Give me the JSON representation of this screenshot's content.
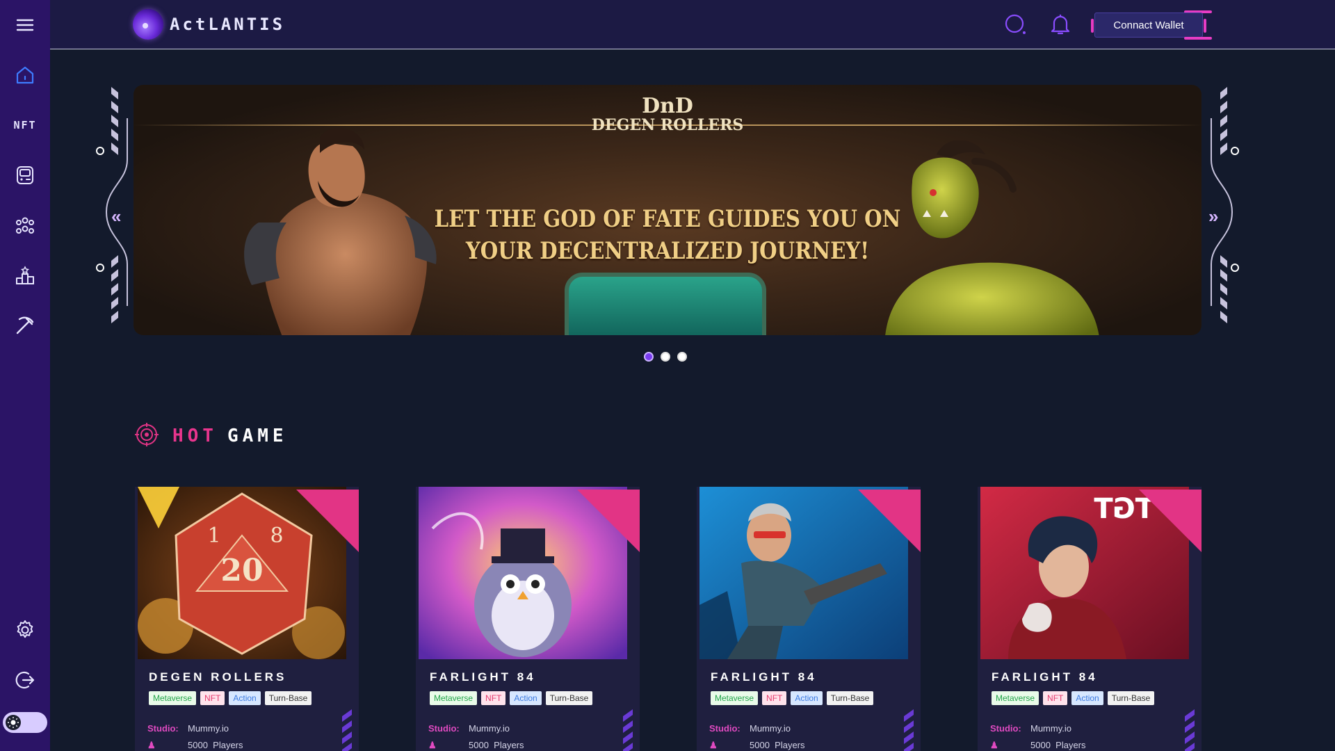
{
  "header": {
    "logo_text": "ActLANTIS",
    "connect_wallet_label": "Connact Wallet"
  },
  "sidebar": {
    "items": [
      {
        "name": "home",
        "icon": "home-icon"
      },
      {
        "name": "nft",
        "label": "NFT"
      },
      {
        "name": "games",
        "icon": "gamepad-icon"
      },
      {
        "name": "community",
        "icon": "users-icon"
      },
      {
        "name": "leaderboard",
        "icon": "podium-icon"
      },
      {
        "name": "mining",
        "icon": "pickaxe-icon"
      },
      {
        "name": "settings",
        "icon": "gear-icon"
      },
      {
        "name": "logout",
        "icon": "logout-icon"
      }
    ]
  },
  "banner": {
    "logo_line1": "DnD",
    "logo_line2": "DEGEN ROLLERS",
    "headline_line1": "LET THE GOD OF FATE GUIDES YOU ON",
    "headline_line2": "YOUR DECENTRALIZED JOURNEY!",
    "prev_arrow": "«",
    "next_arrow": "»",
    "slides": 3,
    "active_slide": 1
  },
  "hot_game": {
    "title_part1": "HOT",
    "title_part2": "GAME",
    "cards": [
      {
        "title": "DEGEN ROLLERS",
        "tags": [
          "Metaverse",
          "NFT",
          "Action",
          "Turn-Base"
        ],
        "studio_label": "Studio:",
        "studio": "Mummy.io",
        "players": "5000",
        "players_label": "Players",
        "art": "dice"
      },
      {
        "title": "FARLIGHT 84",
        "tags": [
          "Metaverse",
          "NFT",
          "Action",
          "Turn-Base"
        ],
        "studio_label": "Studio:",
        "studio": "Mummy.io",
        "players": "5000",
        "players_label": "Players",
        "art": "penguin"
      },
      {
        "title": "FARLIGHT 84",
        "tags": [
          "Metaverse",
          "NFT",
          "Action",
          "Turn-Base"
        ],
        "studio_label": "Studio:",
        "studio": "Mummy.io",
        "players": "5000",
        "players_label": "Players",
        "art": "soldier"
      },
      {
        "title": "FARLIGHT 84",
        "tags": [
          "Metaverse",
          "NFT",
          "Action",
          "Turn-Base"
        ],
        "studio_label": "Studio:",
        "studio": "Mummy.io",
        "players": "5000",
        "players_label": "Players",
        "art": "hero"
      }
    ]
  },
  "colors": {
    "sidebar_bg": "#2b1466",
    "page_bg": "#131a2c",
    "accent_pink": "#e23485",
    "accent_purple": "#7a3cf0"
  }
}
